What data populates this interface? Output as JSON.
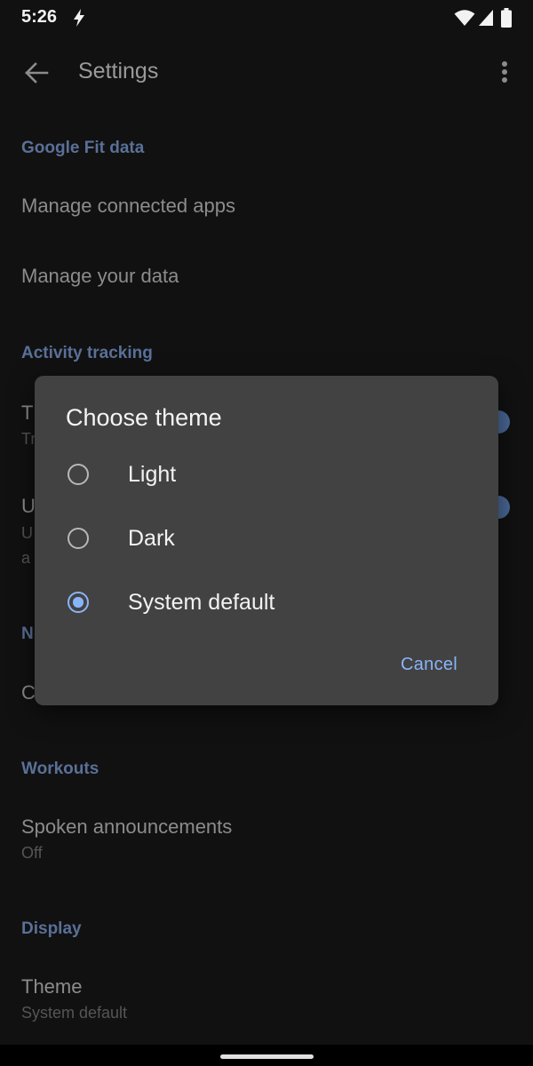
{
  "status_bar": {
    "time": "5:26",
    "icons": [
      "flash-icon",
      "wifi-icon",
      "signal-icon",
      "battery-icon"
    ]
  },
  "app_bar": {
    "title": "Settings",
    "back_icon": "arrow-left-icon",
    "overflow_icon": "more-vert-icon"
  },
  "settings": {
    "google_fit_header": "Google Fit data",
    "manage_connected_apps": "Manage connected apps",
    "manage_your_data": "Manage your data",
    "activity_tracking_header": "Activity tracking",
    "track_title_partial": "T",
    "track_summary_partial": "Tr",
    "use_title_partial": "U",
    "use_summary_partial_1": "U",
    "use_summary_partial_2": "a",
    "notifications_header_partial": "N",
    "c_item_partial": "C",
    "workouts_header": "Workouts",
    "spoken_announcements": "Spoken announcements",
    "spoken_announcements_value": "Off",
    "display_header": "Display",
    "theme_title": "Theme",
    "theme_value": "System default"
  },
  "dialog": {
    "title": "Choose theme",
    "options": [
      {
        "label": "Light",
        "selected": false
      },
      {
        "label": "Dark",
        "selected": false
      },
      {
        "label": "System default",
        "selected": true
      }
    ],
    "cancel_label": "Cancel"
  },
  "colors": {
    "accent": "#8ab4f8",
    "dialog_bg": "#424242",
    "page_bg": "#111111"
  }
}
